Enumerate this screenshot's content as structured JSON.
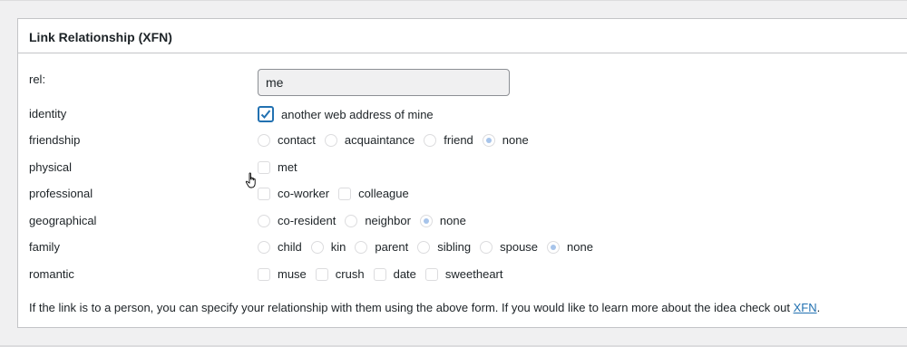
{
  "box": {
    "title": "Link Relationship (XFN)"
  },
  "rel": {
    "label": "rel:",
    "value": "me"
  },
  "identity": {
    "label": "identity",
    "options": [
      {
        "label": "another web address of mine",
        "checked": true
      }
    ]
  },
  "friendship": {
    "label": "friendship",
    "options": [
      {
        "label": "contact",
        "selected": false
      },
      {
        "label": "acquaintance",
        "selected": false
      },
      {
        "label": "friend",
        "selected": false
      },
      {
        "label": "none",
        "selected": true
      }
    ]
  },
  "physical": {
    "label": "physical",
    "options": [
      {
        "label": "met",
        "checked": false
      }
    ]
  },
  "professional": {
    "label": "professional",
    "options": [
      {
        "label": "co-worker",
        "checked": false
      },
      {
        "label": "colleague",
        "checked": false
      }
    ]
  },
  "geographical": {
    "label": "geographical",
    "options": [
      {
        "label": "co-resident",
        "selected": false
      },
      {
        "label": "neighbor",
        "selected": false
      },
      {
        "label": "none",
        "selected": true
      }
    ]
  },
  "family": {
    "label": "family",
    "options": [
      {
        "label": "child",
        "selected": false
      },
      {
        "label": "kin",
        "selected": false
      },
      {
        "label": "parent",
        "selected": false
      },
      {
        "label": "sibling",
        "selected": false
      },
      {
        "label": "spouse",
        "selected": false
      },
      {
        "label": "none",
        "selected": true
      }
    ]
  },
  "romantic": {
    "label": "romantic",
    "options": [
      {
        "label": "muse",
        "checked": false
      },
      {
        "label": "crush",
        "checked": false
      },
      {
        "label": "date",
        "checked": false
      },
      {
        "label": "sweetheart",
        "checked": false
      }
    ]
  },
  "help": {
    "text": "If the link is to a person, you can specify your relationship with them using the above form. If you would like to learn more about the idea check out ",
    "link": "XFN",
    "after": "."
  },
  "colors": {
    "accent": "#2271b1",
    "radio_selected": "#a7c4ea",
    "border": "#c3c4c7"
  }
}
